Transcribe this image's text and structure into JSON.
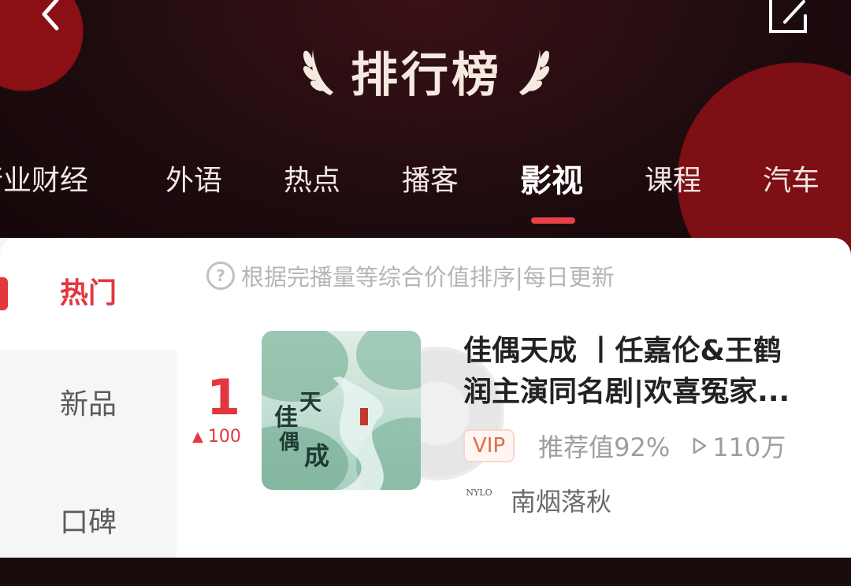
{
  "header": {
    "title": "排行榜",
    "icons": {
      "back": "chevron-left-icon",
      "share": "share-icon"
    }
  },
  "tabs": [
    {
      "label": "行业财经"
    },
    {
      "label": "外语"
    },
    {
      "label": "热点"
    },
    {
      "label": "播客"
    },
    {
      "label": "影视",
      "active": true
    },
    {
      "label": "课程"
    },
    {
      "label": "汽车"
    }
  ],
  "sidebar": {
    "items": [
      {
        "label": "热门",
        "active": true
      },
      {
        "label": "新品"
      },
      {
        "label": "口碑"
      }
    ]
  },
  "hint": {
    "text": "根据完播量等综合价值排序|每日更新"
  },
  "list": {
    "items": [
      {
        "rank": "1",
        "change": "100",
        "cover_text": {
          "title_chars": "佳偶天成"
        },
        "title_line1": "佳偶天成 丨任嘉伦&王鹤",
        "title_line2": "润主演同名剧|欢喜冤家...",
        "badge": "VIP",
        "recommend": "推荐值92%",
        "plays": "110万",
        "author_logo": "NYLO",
        "author": "南烟落秋"
      }
    ]
  },
  "colors": {
    "accent": "#e2373f",
    "header_bg": "#1d0b0e",
    "vip_text": "#e06e45"
  }
}
